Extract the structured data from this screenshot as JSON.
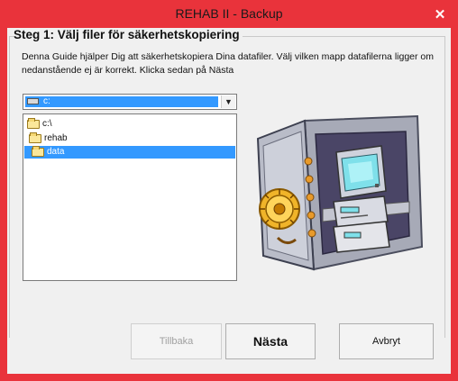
{
  "window": {
    "title": "REHAB II - Backup",
    "close_glyph": "✕"
  },
  "step": {
    "title": "Steg 1: Välj filer för säkerhetskopiering",
    "description": "Denna Guide hjälper Dig att säkerhetskopiera Dina datafiler. Välj vilken mapp datafilerna ligger om nedanstående ej är korrekt. Klicka sedan på Nästa"
  },
  "drive_select": {
    "value": "c:",
    "icon": "drive-icon"
  },
  "folder_tree": {
    "items": [
      {
        "label": "c:\\",
        "icon": "folder-open-icon",
        "selected": false
      },
      {
        "label": "rehab",
        "icon": "folder-open-icon",
        "selected": false
      },
      {
        "label": "data",
        "icon": "folder-open-icon",
        "selected": true
      }
    ]
  },
  "illustration": {
    "icon": "safe-with-computer-icon"
  },
  "buttons": {
    "back": "Tillbaka",
    "next": "Nästa",
    "cancel": "Avbryt"
  },
  "colors": {
    "titlebar": "#e9333b",
    "selection": "#3399ff",
    "dialog": "#f0f0f0"
  }
}
